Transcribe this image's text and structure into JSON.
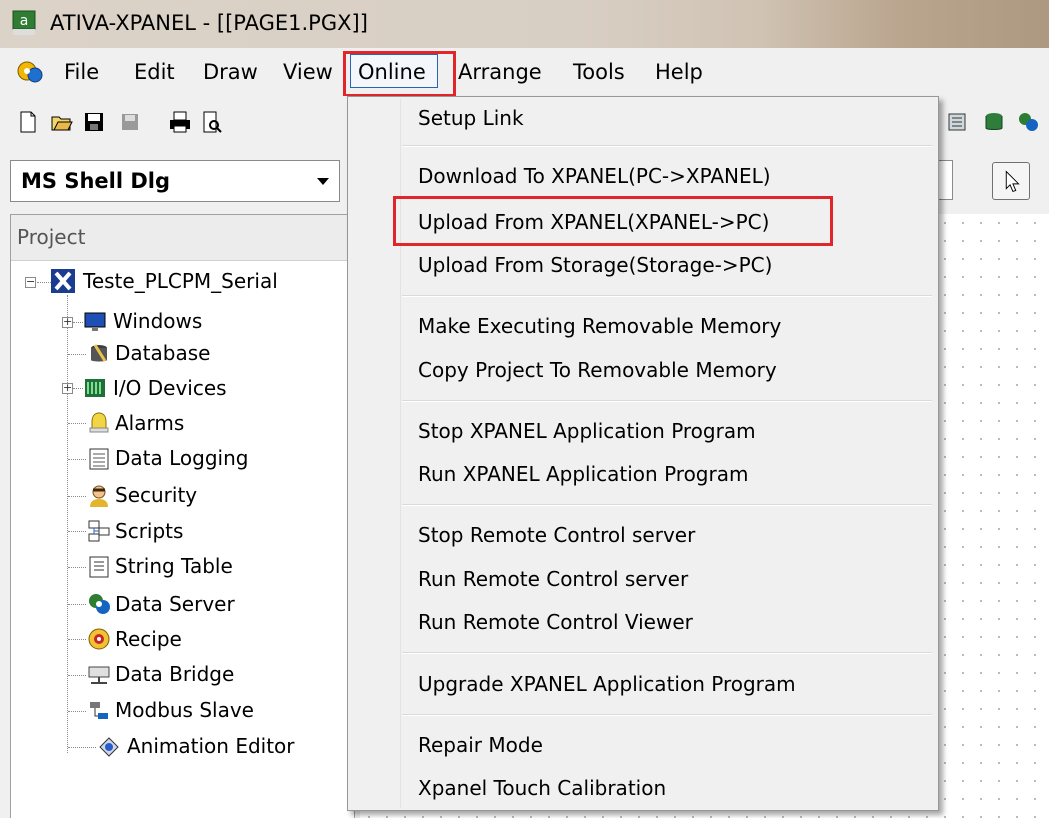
{
  "window": {
    "title": "ATIVA-XPANEL - [[PAGE1.PGX]]"
  },
  "menubar": {
    "items": [
      "File",
      "Edit",
      "Draw",
      "View",
      "Online",
      "Arrange",
      "Tools",
      "Help"
    ]
  },
  "font_combo": {
    "value": "MS Shell Dlg"
  },
  "project": {
    "header": "Project",
    "root": "Teste_PLCPM_Serial",
    "items": [
      "Windows",
      "Database",
      "I/O Devices",
      "Alarms",
      "Data Logging",
      "Security",
      "Scripts",
      "String Table",
      "Data Server",
      "Recipe",
      "Data Bridge",
      "Modbus Slave",
      "Animation Editor"
    ]
  },
  "online_menu": {
    "items": [
      "Setup Link",
      "Download To XPANEL(PC->XPANEL)",
      "Upload From XPANEL(XPANEL->PC)",
      "Upload From Storage(Storage->PC)",
      "Make Executing Removable Memory",
      "Copy Project To Removable Memory",
      "Stop XPANEL Application Program",
      "Run XPANEL Application Program",
      "Stop Remote Control server",
      "Run Remote Control server",
      "Run Remote Control Viewer",
      "Upgrade XPANEL Application Program",
      "Repair Mode",
      "Xpanel Touch Calibration"
    ]
  },
  "colors": {
    "highlight_red": "#e0262b",
    "menu_hover_border": "#2b62b3"
  }
}
